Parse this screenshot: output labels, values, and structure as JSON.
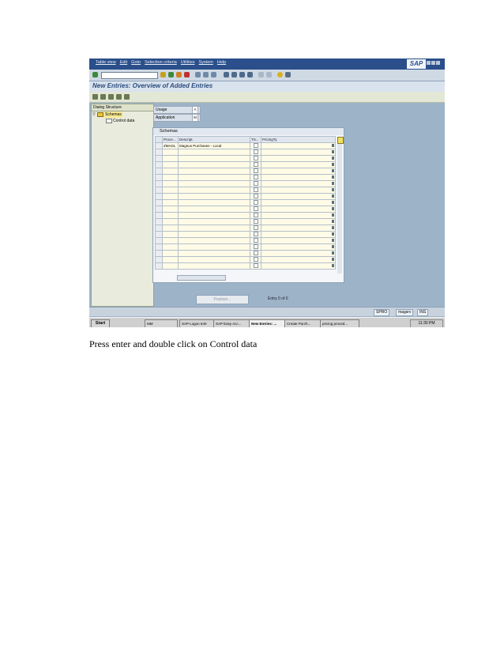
{
  "menu": {
    "items": [
      "Table view",
      "Edit",
      "Goto",
      "Selection criteria",
      "Utilities",
      "System",
      "Help"
    ],
    "logo": "SAP"
  },
  "title": "New Entries: Overview of Added Entries",
  "dialog_structure": {
    "header": "Dialog Structure",
    "items": [
      {
        "label": "Schemas",
        "selected": true
      },
      {
        "label": "Control data",
        "selected": false
      }
    ]
  },
  "fields": [
    {
      "label": "Usage",
      "value": "A"
    },
    {
      "label": "Application",
      "value": "M"
    }
  ],
  "table": {
    "caption": "Schemas",
    "columns": [
      "Proce...",
      "Descript.",
      "TS...",
      "PricingTy"
    ],
    "rows": [
      {
        "proc": "ZMAGL",
        "desc": "Magnus Purchases - Local"
      }
    ]
  },
  "position_button": "Position...",
  "entry_status": "Entry 0 of 0",
  "status_bar": {
    "tcode": "SPRO",
    "server": "magsrv",
    "mode": "INS"
  },
  "taskbar": {
    "start": "Start",
    "tasks": [
      "MM",
      "SAP Logon 640",
      "SAP Easy Acc...",
      "New Entries: ...",
      "Create Purch...",
      "pricing proced..."
    ],
    "clock": "11:30 PM"
  },
  "caption": "Press enter and double click on Control data"
}
